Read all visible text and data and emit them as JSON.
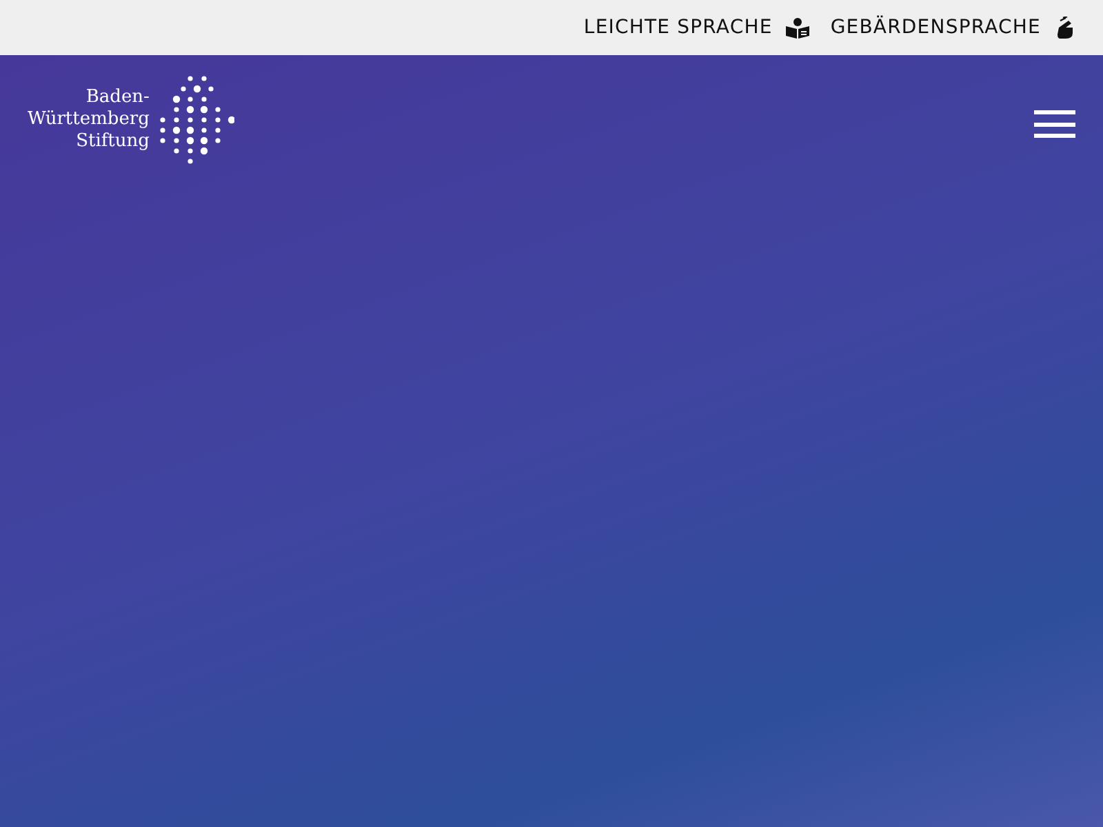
{
  "top_bar": {
    "links": [
      {
        "label": "LEICHTE SPRACHE",
        "kind": "easy-language"
      },
      {
        "label": "GEBÄRDENSPRACHE",
        "kind": "sign-language"
      }
    ]
  },
  "header": {
    "logo_lines": [
      "Baden-",
      "Württemberg",
      "Stiftung"
    ]
  }
}
